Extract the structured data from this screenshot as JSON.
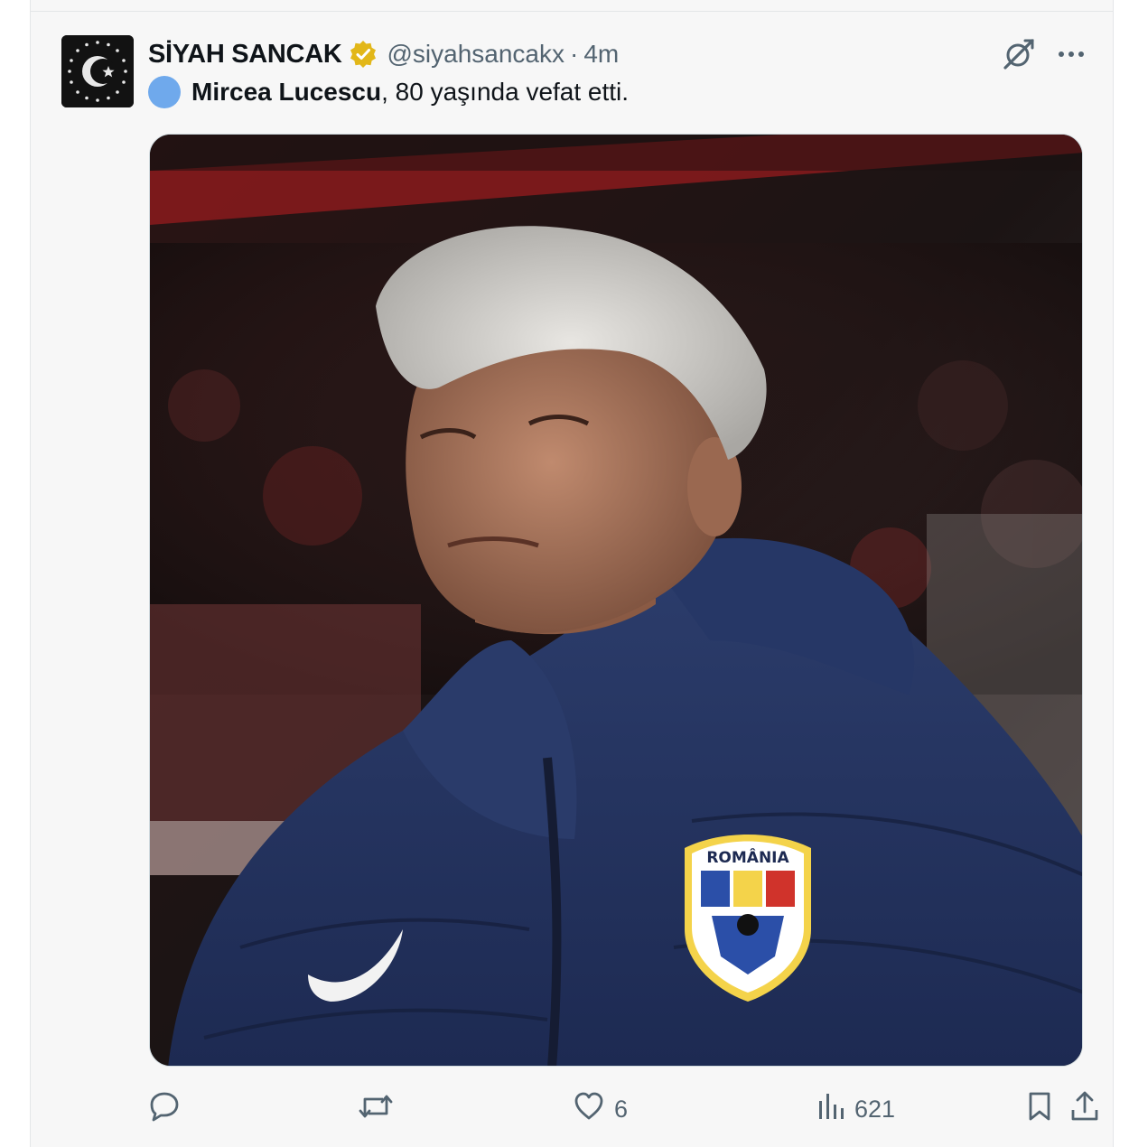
{
  "post": {
    "author": {
      "display_name": "SİYAH SANCAK",
      "handle": "@siyahsancakx",
      "separator": "·",
      "timestamp": "4m",
      "verified_color": "#e2b719"
    },
    "text": {
      "subject": "Mircea Lucescu",
      "rest": ", 80 yaşında vefat etti."
    },
    "media": {
      "badge_text": "ROMÂNIA"
    },
    "stats": {
      "replies": "",
      "reposts": "",
      "likes": "6",
      "views": "621"
    }
  },
  "colors": {
    "muted": "#536471",
    "text": "#0f1419",
    "dot": "#6fa9ec"
  },
  "icons": [
    "grok-icon",
    "more-icon",
    "reply-icon",
    "repost-icon",
    "like-icon",
    "views-icon",
    "bookmark-icon",
    "share-icon"
  ]
}
